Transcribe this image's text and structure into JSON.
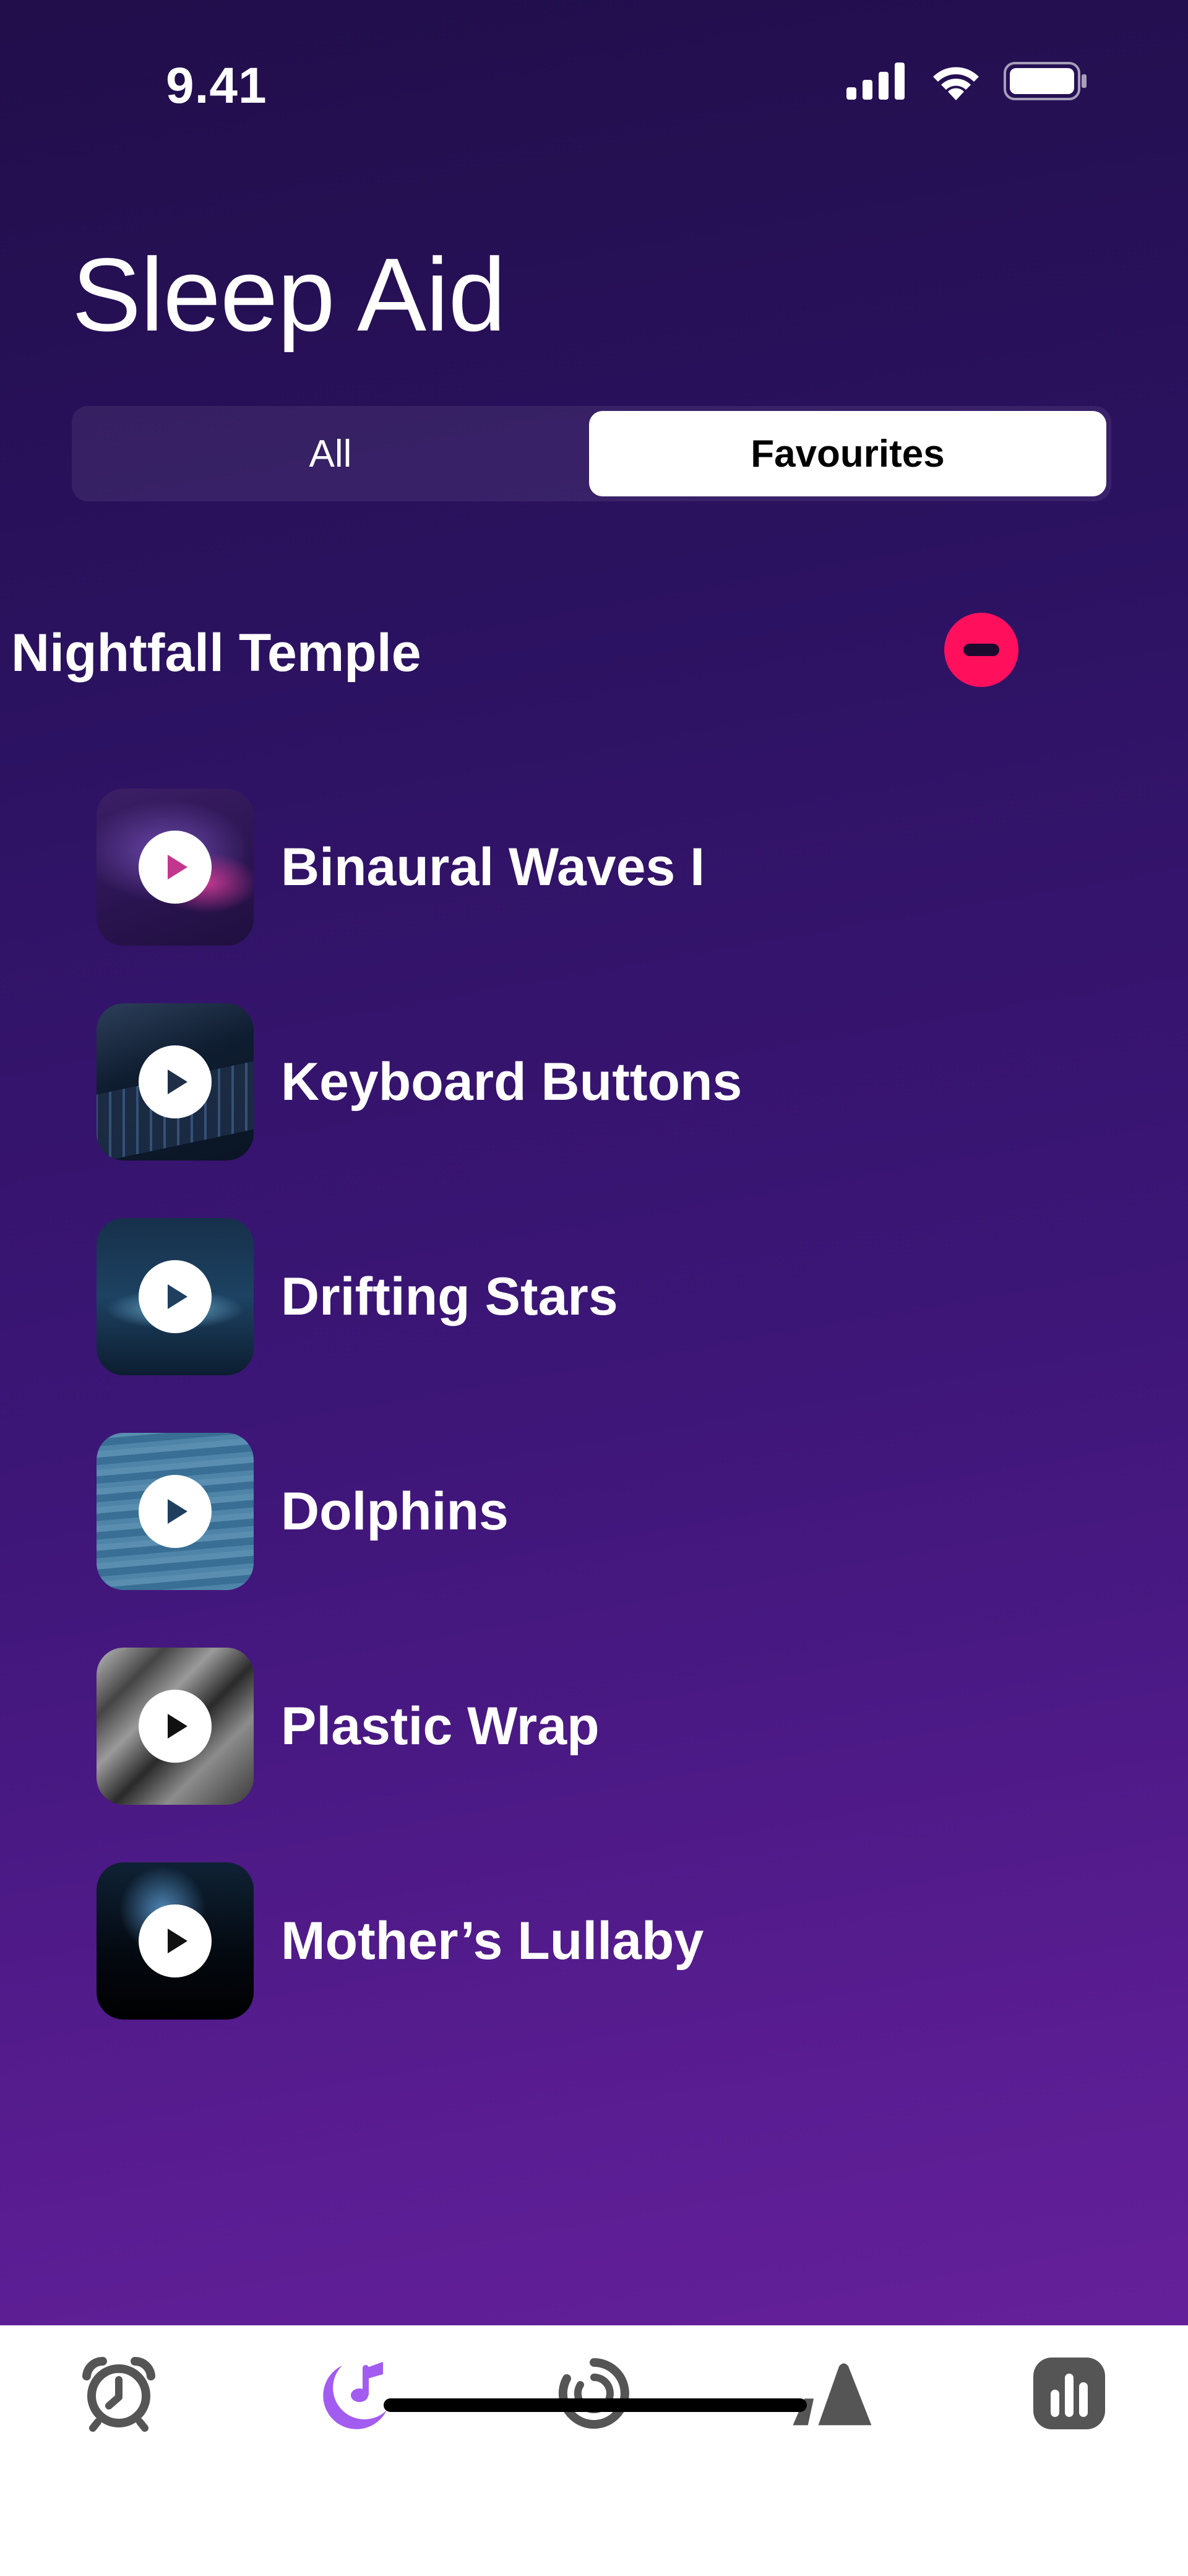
{
  "status_bar": {
    "time": "9.41",
    "icons": [
      "cellular-signal-icon",
      "wifi-icon",
      "battery-icon"
    ]
  },
  "page": {
    "title": "Sleep Aid"
  },
  "segments": {
    "all_label": "All",
    "favourites_label": "Favourites",
    "selected": "Favourites"
  },
  "section": {
    "title": "Nightfall Temple"
  },
  "sounds": [
    {
      "label": "Binaural Waves I",
      "icon": "play-icon",
      "accent": "#c2378e"
    },
    {
      "label": "Keyboard Buttons",
      "icon": "play-icon",
      "accent": "#1f2f47"
    },
    {
      "label": "Drifting Stars",
      "icon": "play-icon",
      "accent": "#1f3f5f"
    },
    {
      "label": "Dolphins",
      "icon": "play-icon",
      "accent": "#1f3f5f"
    },
    {
      "label": "Plastic Wrap",
      "icon": "play-icon",
      "accent": "#111111"
    },
    {
      "label": "Mother’s Lullaby",
      "icon": "play-icon",
      "accent": "#111111"
    }
  ],
  "tab_bar": {
    "items": [
      "alarm-clock-icon",
      "sleep-moon-music-icon",
      "progress-ring-icon",
      "mountains-icon",
      "stats-chart-icon"
    ],
    "active": "sleep-moon-music-icon",
    "active_color": "#a25cf0",
    "inactive_color": "#555555"
  },
  "colors": {
    "remove_button": "#ff0f5c",
    "background_top": "#210e4a",
    "background_bottom": "#6d22a0"
  }
}
